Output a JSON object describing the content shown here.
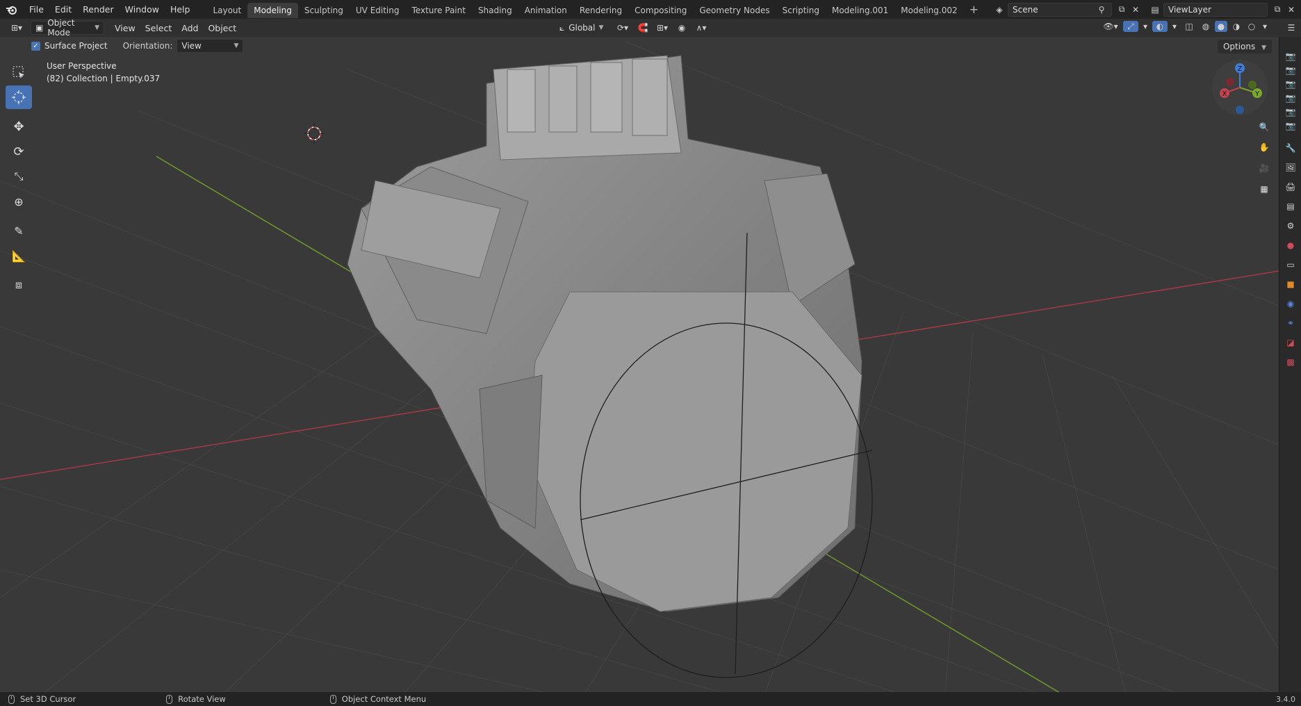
{
  "menubar": {
    "items": [
      "File",
      "Edit",
      "Render",
      "Window",
      "Help"
    ],
    "workspaces": [
      "Layout",
      "Modeling",
      "Sculpting",
      "UV Editing",
      "Texture Paint",
      "Shading",
      "Animation",
      "Rendering",
      "Compositing",
      "Geometry Nodes",
      "Scripting",
      "Modeling.001",
      "Modeling.002"
    ],
    "active_workspace": "Modeling",
    "add_symbol": "+",
    "scene": "Scene",
    "view_layer": "ViewLayer"
  },
  "header": {
    "mode": "Object Mode",
    "menus": [
      "View",
      "Select",
      "Add",
      "Object"
    ],
    "transform_orientation": "Global"
  },
  "tool_settings": {
    "surface_project_label": "Surface Project",
    "surface_project_checked": true,
    "orientation_label": "Orientation:",
    "orientation_value": "View",
    "options_label": "Options"
  },
  "viewport": {
    "perspective_label": "User Perspective",
    "collection_info": "(82) Collection | Empty.037"
  },
  "gizmo": {
    "z": "Z",
    "y": "Y",
    "x": "X"
  },
  "status": {
    "left_action": "Set 3D Cursor",
    "middle_action": "Rotate View",
    "right_action": "Object Context Menu",
    "version": "3.4.0"
  },
  "colors": {
    "accent": "#4772b3",
    "x_axis": "#c6424f",
    "y_axis": "#7aa82b",
    "z_axis": "#3d7fd8"
  }
}
